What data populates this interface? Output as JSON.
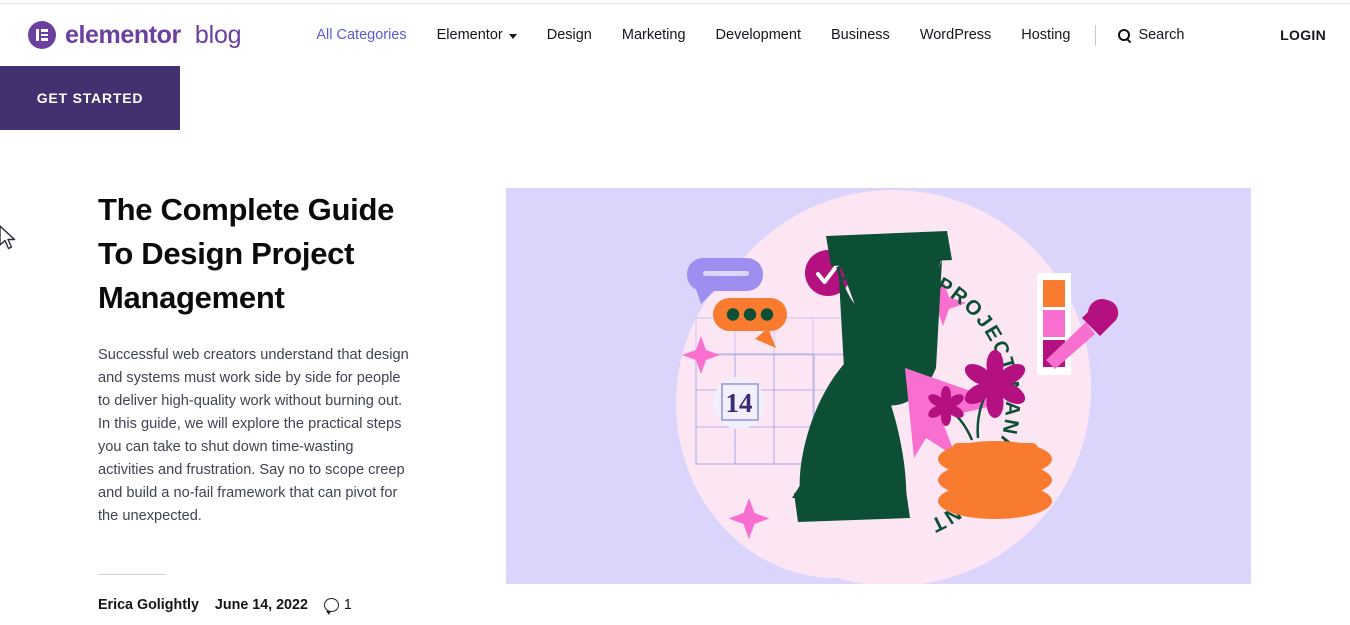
{
  "header": {
    "brand": {
      "name": "elementor",
      "sub": "blog",
      "logo_icon": "elementor-logo-icon"
    },
    "nav": [
      {
        "label": "All Categories",
        "accent": true,
        "has_caret": false
      },
      {
        "label": "Elementor",
        "accent": false,
        "has_caret": true
      },
      {
        "label": "Design",
        "accent": false,
        "has_caret": false
      },
      {
        "label": "Marketing",
        "accent": false,
        "has_caret": false
      },
      {
        "label": "Development",
        "accent": false,
        "has_caret": false
      },
      {
        "label": "Business",
        "accent": false,
        "has_caret": false
      },
      {
        "label": "WordPress",
        "accent": false,
        "has_caret": false
      },
      {
        "label": "Hosting",
        "accent": false,
        "has_caret": false
      }
    ],
    "search_label": "Search",
    "search_icon": "search-icon",
    "login_label": "LOGIN"
  },
  "get_started": {
    "label": "GET STARTED",
    "bg": "#43306f",
    "text_color": "#ffffff"
  },
  "article": {
    "title": "The Complete Guide To Design Project Management",
    "excerpt": "Successful web creators understand that design and systems must work side by side for people to deliver high-quality work without burning out. In this guide, we will explore the practical steps you can take to shut down time-wasting activities and frustration. Say no to scope creep and build a no-fail framework that can pivot for the unexpected.",
    "author": "Erica Golightly",
    "date": "June 14, 2022",
    "comment_count": "1",
    "comment_icon": "comment-bubble-icon"
  },
  "illustration": {
    "alt": "design-project-management-illustration",
    "background": "#dcd5fb",
    "blob_color": "#fde6f4",
    "circular_text": "DESIGN PROJECT MANAGEMENT",
    "calendar_day": "14",
    "colors": {
      "dark_green": "#0d4f35",
      "magenta": "#b4107f",
      "orange": "#f97b2f",
      "pink": "#f86fd0",
      "periwinkle": "#9d8ef0",
      "swatch_orange": "#f97b2f",
      "swatch_pink": "#f86fd0",
      "swatch_magenta": "#b4107f",
      "calendar_text": "#3b2a74"
    }
  },
  "accent_colors": {
    "brand_purple": "#6b3fa0",
    "nav_accent": "#5b5bd6",
    "ribbon_purple": "#43306f"
  }
}
